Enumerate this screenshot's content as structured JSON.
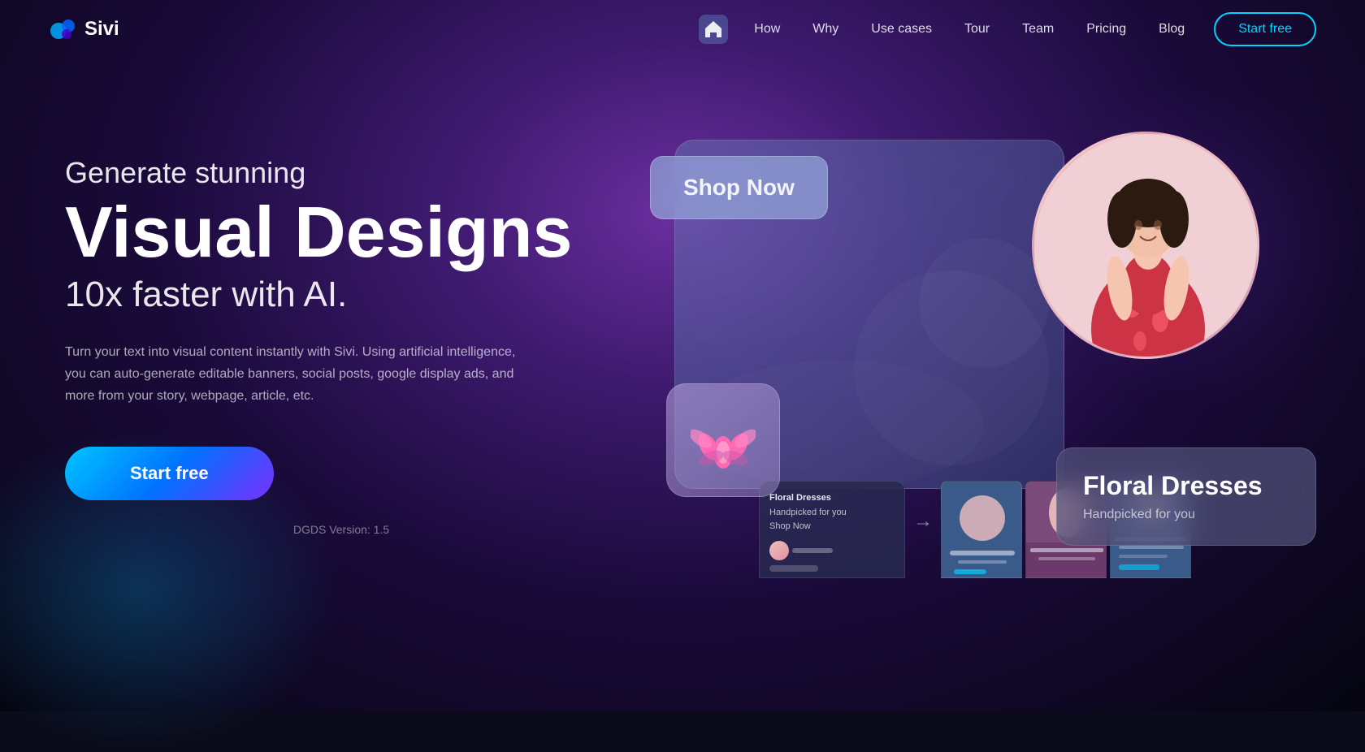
{
  "brand": {
    "name": "Sivi",
    "logo_alt": "Sivi logo"
  },
  "nav": {
    "home_icon_alt": "home",
    "links": [
      {
        "id": "how",
        "label": "How"
      },
      {
        "id": "why",
        "label": "Why"
      },
      {
        "id": "use-cases",
        "label": "Use cases"
      },
      {
        "id": "tour",
        "label": "Tour"
      },
      {
        "id": "team",
        "label": "Team"
      },
      {
        "id": "pricing",
        "label": "Pricing"
      },
      {
        "id": "blog",
        "label": "Blog"
      }
    ],
    "cta_label": "Start free"
  },
  "hero": {
    "subtitle": "Generate stunning",
    "title": "Visual Designs",
    "tagline": "10x faster with AI.",
    "description": "Turn your text into visual content instantly with Sivi. Using artificial intelligence, you can auto-generate editable banners, social posts, google display ads, and more from your story, webpage, article, etc.",
    "cta_label": "Start free",
    "version": "DGDS Version: 1.5"
  },
  "preview": {
    "shop_now_label": "Shop Now",
    "floral_title": "Floral Dresses",
    "floral_subtitle": "Handpicked for you",
    "lotus_emoji": "🪷",
    "input_text_line1": "Floral Dresses",
    "input_text_line2": "Handpicked for you",
    "input_text_line3": "Shop Now"
  }
}
